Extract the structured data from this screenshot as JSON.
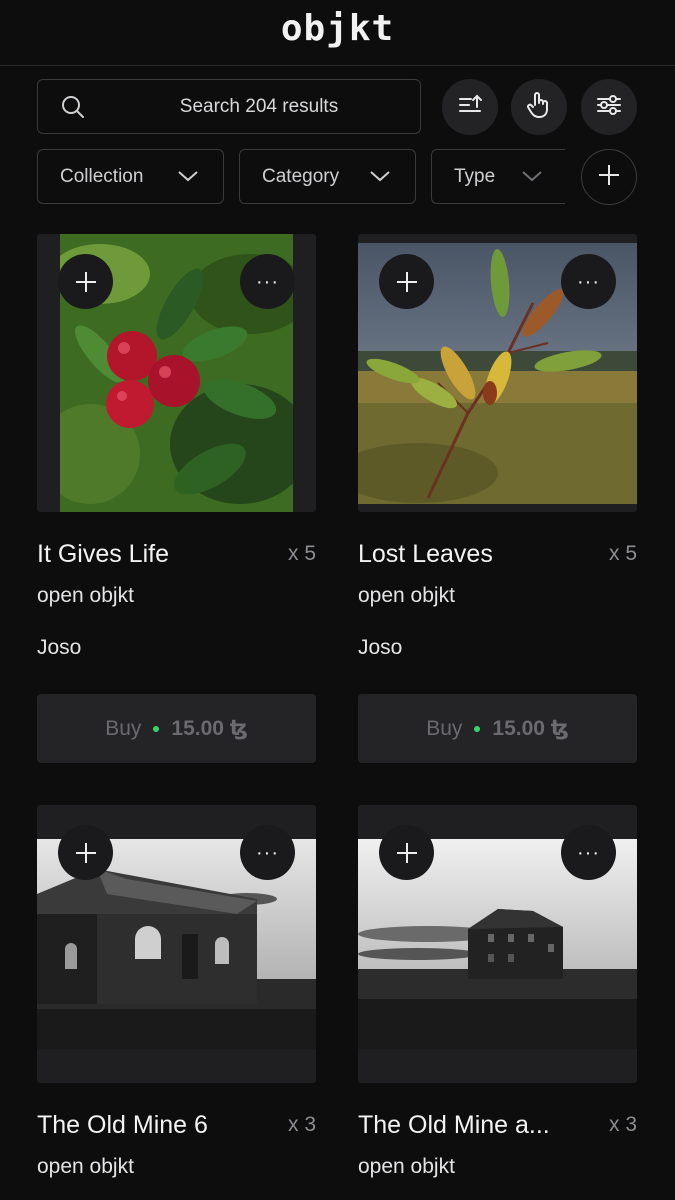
{
  "app": {
    "logo": "objkt"
  },
  "search": {
    "placeholder": "Search 204 results"
  },
  "toolbar": {
    "sort_icon": "sort-ascending-icon",
    "gesture_icon": "hand-pointer-icon",
    "settings_icon": "sliders-icon",
    "add_icon": "plus-icon"
  },
  "filters": [
    {
      "label": "Collection"
    },
    {
      "label": "Category"
    },
    {
      "label": "Type"
    }
  ],
  "colors": {
    "background": "#0d0d0e",
    "button": "#242427",
    "price_dot": "#3bd36b"
  },
  "items": [
    {
      "title": "It Gives Life",
      "editions": "x 5",
      "collection": "open objkt",
      "artist": "Joso",
      "buy_label": "Buy",
      "price": "15.00 ꜩ",
      "image": "red lingonberries on green leaves"
    },
    {
      "title": "Lost Leaves",
      "editions": "x 5",
      "collection": "open objkt",
      "artist": "Joso",
      "buy_label": "Buy",
      "price": "15.00 ꜩ",
      "image": "autumn leaves on twig in field"
    },
    {
      "title": "The Old Mine 6",
      "editions": "x 3",
      "collection": "open objkt",
      "image": "black and white stone building"
    },
    {
      "title": "The Old Mine a...",
      "editions": "x 3",
      "collection": "open objkt",
      "image": "black and white old house"
    }
  ]
}
